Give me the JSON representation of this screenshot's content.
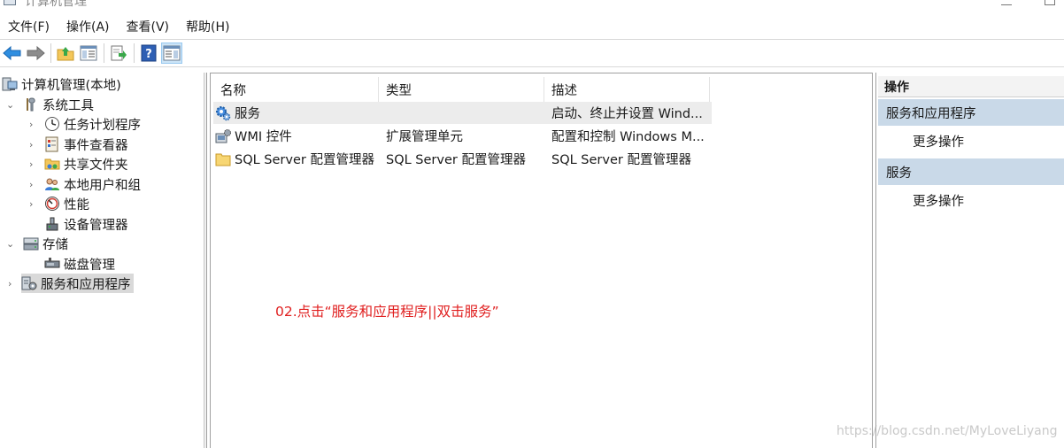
{
  "window": {
    "title": "计算机管理"
  },
  "menu": [
    "文件(F)",
    "操作(A)",
    "查看(V)",
    "帮助(H)"
  ],
  "toolbar_icons": [
    "back-arrow-icon",
    "forward-arrow-icon",
    "up-folder-icon",
    "show-hide-console-tree-icon",
    "export-list-icon",
    "help-icon",
    "show-hide-action-pane-icon"
  ],
  "tree": {
    "root": "计算机管理(本地)",
    "system_tools": "系统工具",
    "task_scheduler": "任务计划程序",
    "event_viewer": "事件查看器",
    "shared_folders": "共享文件夹",
    "local_users": "本地用户和组",
    "performance": "性能",
    "device_manager": "设备管理器",
    "storage": "存储",
    "disk_management": "磁盘管理",
    "services_apps": "服务和应用程序"
  },
  "list": {
    "columns": [
      "名称",
      "类型",
      "描述"
    ],
    "rows": [
      {
        "name": "服务",
        "type": "",
        "desc": "启动、终止并设置 Wind..."
      },
      {
        "name": "WMI 控件",
        "type": "扩展管理单元",
        "desc": "配置和控制 Windows M..."
      },
      {
        "name": "SQL Server 配置管理器",
        "type": "SQL Server 配置管理器",
        "desc": "SQL Server 配置管理器"
      }
    ]
  },
  "annotation": "02.点击“服务和应用程序||双击服务”",
  "watermark": "https://blog.csdn.net/MyLoveLiyang",
  "actions": {
    "header": "操作",
    "group1": "服务和应用程序",
    "group1_more": "更多操作",
    "group2": "服务",
    "group2_more": "更多操作"
  },
  "colors": {
    "annotation": "#e02020",
    "action_group_bg": "#c9d9e8",
    "selection_bg": "#d9d9d9"
  }
}
